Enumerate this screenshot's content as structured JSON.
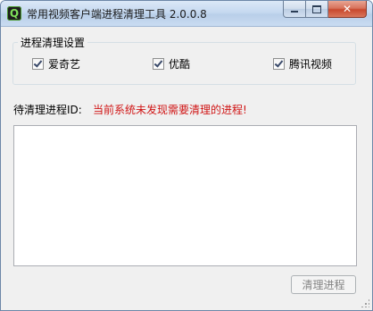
{
  "window": {
    "title": "常用视频客户端进程清理工具 2.0.0.8",
    "icon": "app-q-icon"
  },
  "titlebar_buttons": {
    "minimize": "minimize-icon",
    "maximize": "maximize-icon",
    "close": "close-icon"
  },
  "settings_group": {
    "legend": "进程清理设置",
    "checkboxes": [
      {
        "label": "爱奇艺",
        "checked": true
      },
      {
        "label": "优酷",
        "checked": true
      },
      {
        "label": "腾讯视频",
        "checked": true
      }
    ]
  },
  "process": {
    "label": "待清理进程ID:",
    "status": "当前系统未发现需要清理的进程!",
    "status_color": "#d01414",
    "items": []
  },
  "actions": {
    "clean_label": "清理进程",
    "clean_enabled": false
  }
}
